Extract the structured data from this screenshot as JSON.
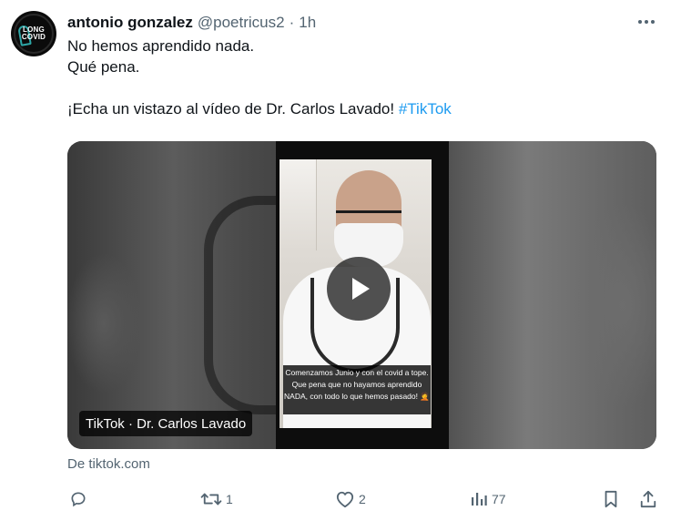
{
  "tweet": {
    "author_name": "antonio gonzalez",
    "author_handle": "@poetricus2",
    "separator": "·",
    "time": "1h",
    "avatar_text": [
      "LONG",
      "COVID"
    ],
    "lines": [
      "No hemos aprendido nada.",
      "Qué pena."
    ],
    "cta_text": "¡Echa un vistazo al vídeo de Dr. Carlos Lavado!",
    "hashtag": "#TikTok"
  },
  "media": {
    "tag_label": "TikTok · Dr. Carlos Lavado",
    "caption_lines": [
      "Comenzamos Junio y con el covid a tope.",
      "Que pena que no hayamos aprendido",
      "NADA, con todo lo que hemos pasado! 🤦"
    ]
  },
  "source": "De tiktok.com",
  "actions": {
    "reply_count": "",
    "retweet_count": "1",
    "like_count": "2",
    "views_count": "77"
  },
  "icons": {
    "more": "more-icon",
    "reply": "reply-icon",
    "retweet": "retweet-icon",
    "like": "heart-icon",
    "views": "views-icon",
    "bookmark": "bookmark-icon",
    "share": "share-icon",
    "play": "play-icon"
  },
  "colors": {
    "link": "#1d9bf0",
    "secondary_text": "#536471",
    "primary_text": "#0f1419"
  }
}
